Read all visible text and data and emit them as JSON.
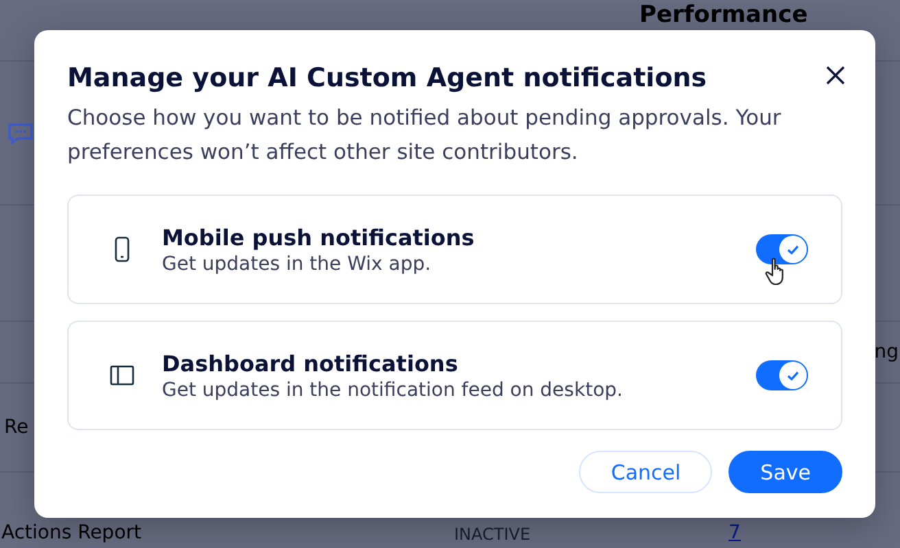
{
  "background": {
    "heading": "Performance",
    "row_texts": [
      "ng",
      "Re"
    ],
    "report": {
      "name": "Actions Report",
      "status": "INACTIVE",
      "count": "7"
    }
  },
  "dialog": {
    "title": "Manage your AI Custom Agent notifications",
    "description": "Choose how you want to be notified about pending approvals. Your preferences won’t affect other site contributors.",
    "options": [
      {
        "kind": "mobile",
        "title": "Mobile push notifications",
        "subtitle": "Get updates in the Wix app.",
        "on": true
      },
      {
        "kind": "dashboard",
        "title": "Dashboard notifications",
        "subtitle": "Get updates in the notification feed on desktop.",
        "on": true
      }
    ],
    "buttons": [
      {
        "kind": "secondary",
        "label": "Cancel"
      },
      {
        "kind": "primary",
        "label": "Save"
      }
    ]
  }
}
